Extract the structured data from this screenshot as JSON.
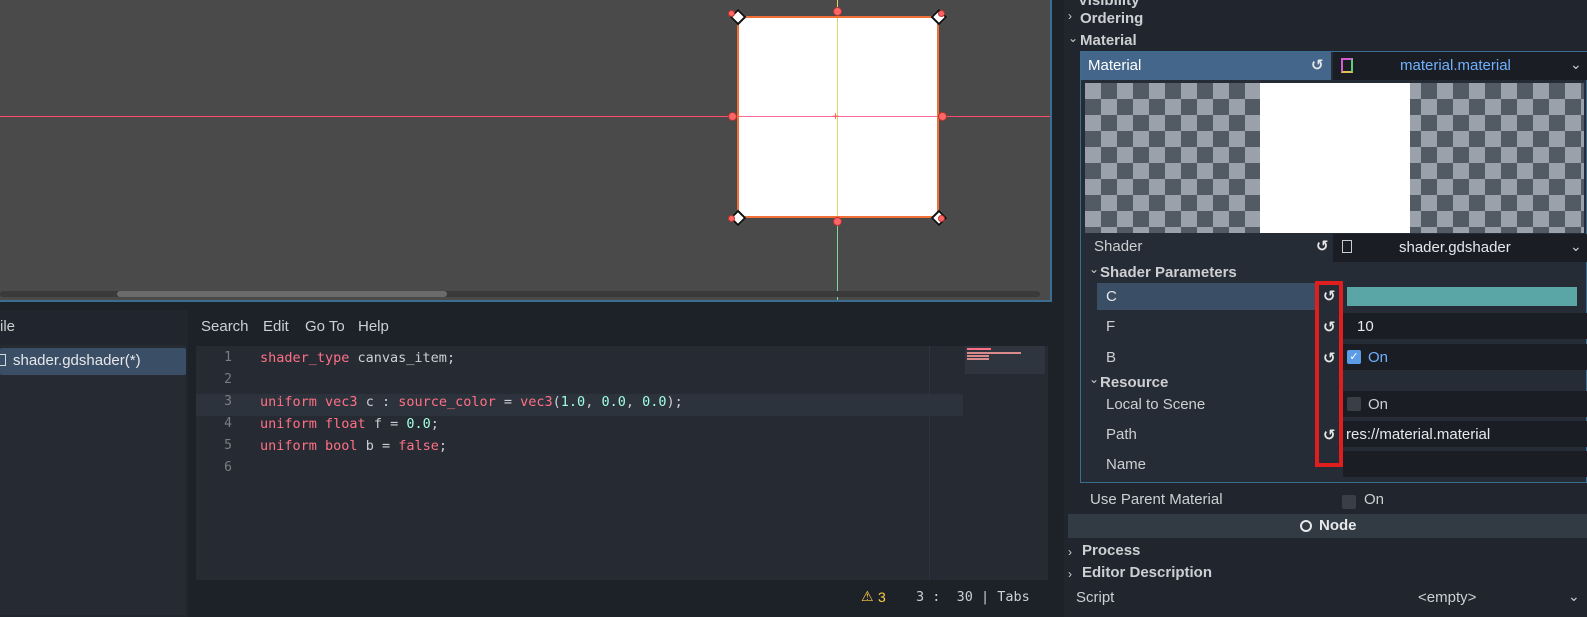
{
  "colors": {
    "accent": "#3d6d8e",
    "selected_row": "#44668a",
    "highlight_box": "#e01e1e",
    "color_swatch": "#5aa6a6",
    "checkbox_on": "#5c9ce6"
  },
  "script_editor": {
    "menu": [
      "ile",
      "Search",
      "Edit",
      "Go To",
      "Help"
    ],
    "open_file": "shader.gdshader(*)",
    "lines": [
      {
        "n": "1",
        "tokens": [
          [
            "kw",
            "shader_type"
          ],
          [
            "pl",
            " canvas_item;"
          ]
        ]
      },
      {
        "n": "2",
        "tokens": []
      },
      {
        "n": "3",
        "tokens": [
          [
            "kw",
            "uniform"
          ],
          [
            "pl",
            " "
          ],
          [
            "ty",
            "vec3"
          ],
          [
            "pl",
            " c : "
          ],
          [
            "kw",
            "source_color"
          ],
          [
            "pl",
            " = "
          ],
          [
            "ty",
            "vec3"
          ],
          [
            "pl",
            "("
          ],
          [
            "num",
            "1.0"
          ],
          [
            "pl",
            ", "
          ],
          [
            "num",
            "0.0"
          ],
          [
            "pl",
            ", "
          ],
          [
            "num",
            "0.0"
          ],
          [
            "pl",
            ");"
          ]
        ]
      },
      {
        "n": "4",
        "tokens": [
          [
            "kw",
            "uniform"
          ],
          [
            "pl",
            " "
          ],
          [
            "ty",
            "float"
          ],
          [
            "pl",
            " f = "
          ],
          [
            "num",
            "0.0"
          ],
          [
            "pl",
            ";"
          ]
        ]
      },
      {
        "n": "5",
        "tokens": [
          [
            "kw",
            "uniform"
          ],
          [
            "pl",
            " "
          ],
          [
            "ty",
            "bool"
          ],
          [
            "pl",
            " b = "
          ],
          [
            "kw",
            "false"
          ],
          [
            "pl",
            ";"
          ]
        ]
      },
      {
        "n": "6",
        "tokens": []
      }
    ],
    "status": {
      "warnings": "3",
      "position": "3 :  30 | Tabs"
    }
  },
  "inspector": {
    "visibility": "Visibility",
    "ordering": "Ordering",
    "material_section": "Material",
    "material_label": "Material",
    "material_value": "material.material",
    "shader_label": "Shader",
    "shader_value": "shader.gdshader",
    "shader_params": "Shader Parameters",
    "param_c": "C",
    "param_f": "F",
    "param_f_value": "10",
    "param_b": "B",
    "param_b_value": "On",
    "resource": "Resource",
    "local_to_scene": "Local to Scene",
    "local_to_scene_value": "On",
    "path": "Path",
    "path_value": "res://material.material",
    "name": "Name",
    "use_parent_material": "Use Parent Material",
    "use_parent_material_value": "On",
    "node_section": "Node",
    "process": "Process",
    "editor_description": "Editor Description",
    "script": "Script",
    "script_value": "<empty>"
  }
}
